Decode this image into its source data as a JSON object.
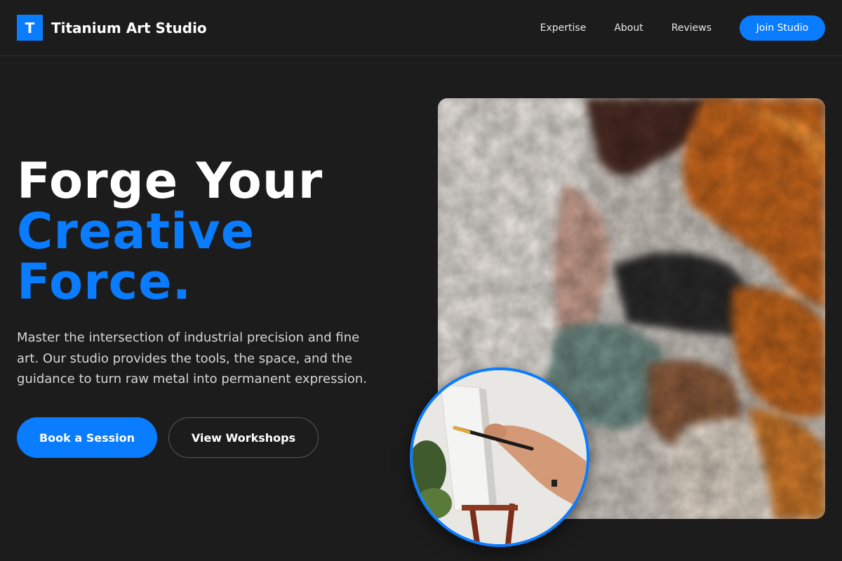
{
  "header": {
    "logo_letter": "T",
    "brand_name": "Titanium Art Studio",
    "nav": [
      "Expertise",
      "About",
      "Reviews"
    ],
    "cta_label": "Join Studio"
  },
  "hero": {
    "title_line1": "Forge Your",
    "title_line2": "Creative",
    "title_line3": "Force.",
    "description": "Master the intersection of industrial precision and fine art. Our studio provides the tools, the space, and the guidance to turn raw metal into permanent expression.",
    "primary_button": "Book a Session",
    "secondary_button": "View Workshops"
  },
  "colors": {
    "accent": "#0a7cff",
    "background": "#1c1c1c"
  },
  "images": {
    "main": "abstract-impasto-paint-image",
    "inset": "painter-at-easel-image"
  }
}
